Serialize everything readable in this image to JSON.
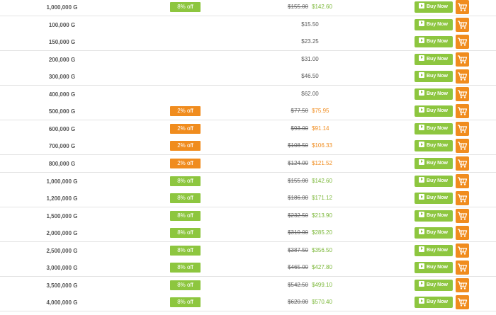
{
  "rows": [
    {
      "amount": "1,000,000 G",
      "discount": "8% off",
      "discount_color": "green",
      "old_price": "$155.00",
      "price": "$142.60",
      "price_color": "green"
    },
    {
      "amount": "100,000 G",
      "discount": "",
      "discount_color": "none",
      "old_price": "",
      "price": "$15.50",
      "price_color": "plain"
    },
    {
      "amount": "150,000 G",
      "discount": "",
      "discount_color": "none",
      "old_price": "",
      "price": "$23.25",
      "price_color": "plain"
    },
    {
      "amount": "200,000 G",
      "discount": "",
      "discount_color": "none",
      "old_price": "",
      "price": "$31.00",
      "price_color": "plain"
    },
    {
      "amount": "300,000 G",
      "discount": "",
      "discount_color": "none",
      "old_price": "",
      "price": "$46.50",
      "price_color": "plain"
    },
    {
      "amount": "400,000 G",
      "discount": "",
      "discount_color": "none",
      "old_price": "",
      "price": "$62.00",
      "price_color": "plain"
    },
    {
      "amount": "500,000 G",
      "discount": "2% off",
      "discount_color": "orange",
      "old_price": "$77.50",
      "price": "$75.95",
      "price_color": "orange"
    },
    {
      "amount": "600,000 G",
      "discount": "2% off",
      "discount_color": "orange",
      "old_price": "$93.00",
      "price": "$91.14",
      "price_color": "orange"
    },
    {
      "amount": "700,000 G",
      "discount": "2% off",
      "discount_color": "orange",
      "old_price": "$108.50",
      "price": "$106.33",
      "price_color": "orange"
    },
    {
      "amount": "800,000 G",
      "discount": "2% off",
      "discount_color": "orange",
      "old_price": "$124.00",
      "price": "$121.52",
      "price_color": "orange"
    },
    {
      "amount": "1,000,000 G",
      "discount": "8% off",
      "discount_color": "green",
      "old_price": "$155.00",
      "price": "$142.60",
      "price_color": "green"
    },
    {
      "amount": "1,200,000 G",
      "discount": "8% off",
      "discount_color": "green",
      "old_price": "$186.00",
      "price": "$171.12",
      "price_color": "green"
    },
    {
      "amount": "1,500,000 G",
      "discount": "8% off",
      "discount_color": "green",
      "old_price": "$232.50",
      "price": "$213.90",
      "price_color": "green"
    },
    {
      "amount": "2,000,000 G",
      "discount": "8% off",
      "discount_color": "green",
      "old_price": "$310.00",
      "price": "$285.20",
      "price_color": "green"
    },
    {
      "amount": "2,500,000 G",
      "discount": "8% off",
      "discount_color": "green",
      "old_price": "$387.50",
      "price": "$356.50",
      "price_color": "green"
    },
    {
      "amount": "3,000,000 G",
      "discount": "8% off",
      "discount_color": "green",
      "old_price": "$465.00",
      "price": "$427.80",
      "price_color": "green"
    },
    {
      "amount": "3,500,000 G",
      "discount": "8% off",
      "discount_color": "green",
      "old_price": "$542.50",
      "price": "$499.10",
      "price_color": "green"
    },
    {
      "amount": "4,000,000 G",
      "discount": "8% off",
      "discount_color": "green",
      "old_price": "$620.00",
      "price": "$570.40",
      "price_color": "green"
    }
  ],
  "buy_label": "Buy Now",
  "icons": {
    "buy": "play-icon",
    "cart": "cart-icon"
  },
  "colors": {
    "green": "#8dc63f",
    "orange": "#f08c1e"
  }
}
